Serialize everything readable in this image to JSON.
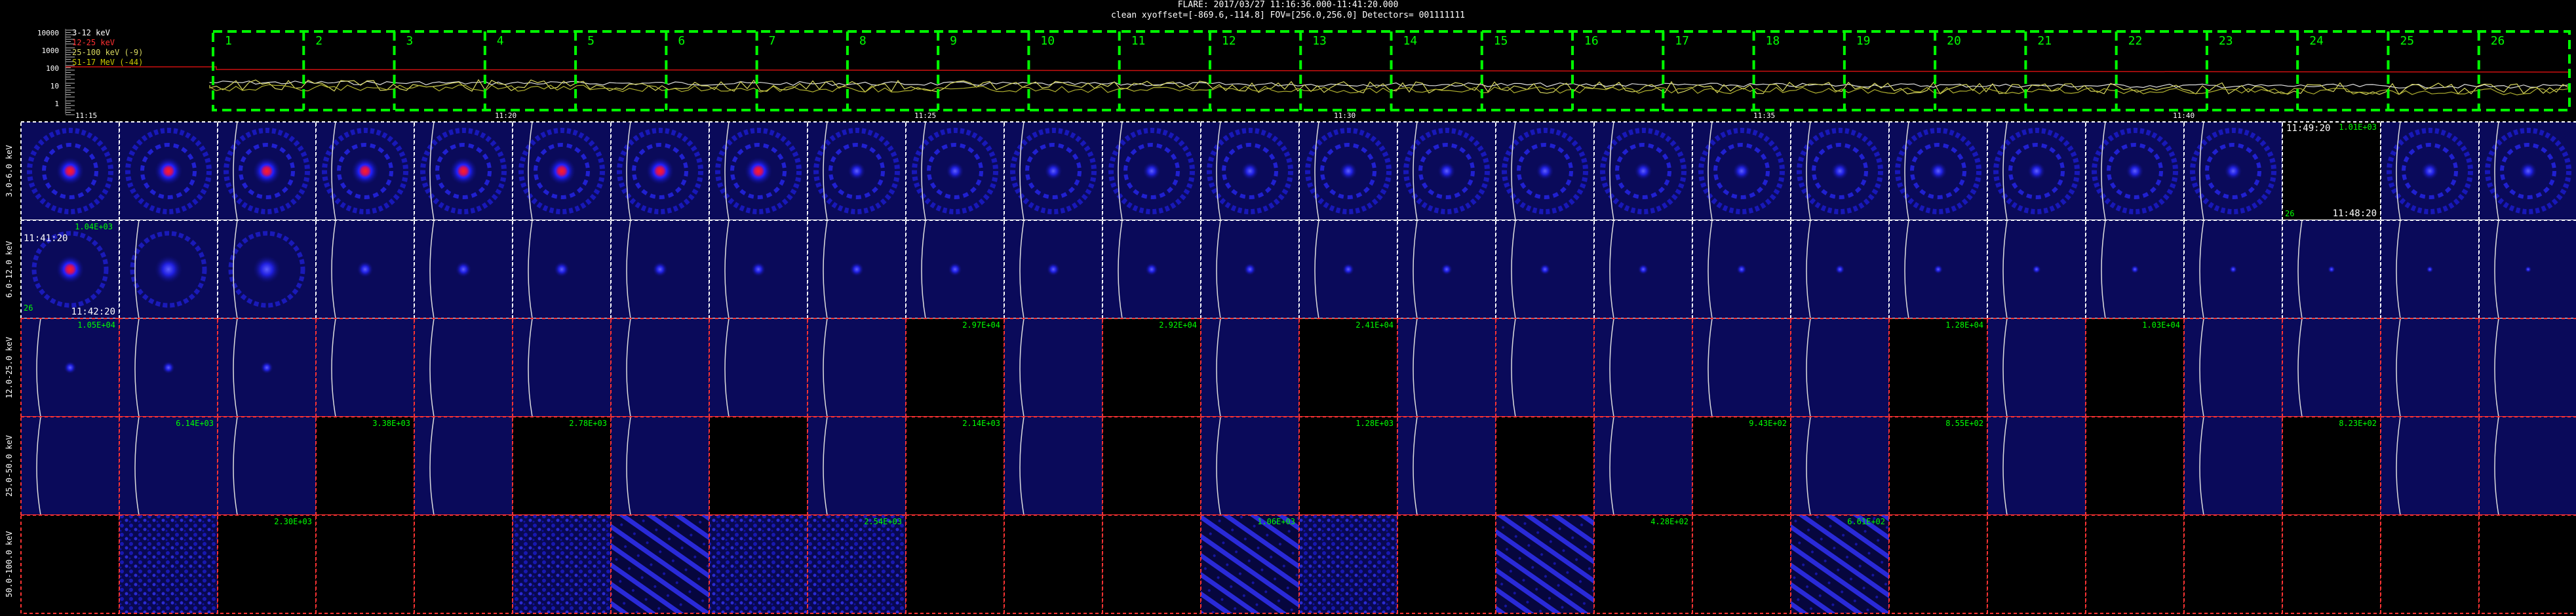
{
  "header": {
    "line1": "FLARE: 2017/03/27  11:16:36.000-11:41:20.000",
    "line2": "clean    xyoffset=[-869.6,-114.8]    FOV=[256.0,256.0]    Detectors= 001111111"
  },
  "lightcurve": {
    "y_ticks": [
      "10000",
      "1000",
      "100",
      "10",
      "1"
    ],
    "legend": [
      "3-12 keV",
      "12-25 keV",
      "25-100 keV (-9)",
      "S1-17 MeV (-44)"
    ],
    "legend_colors": [
      "#ffffff",
      "#ff3030",
      "#d8d860",
      "#c8c800"
    ],
    "time_ticks": [
      "11:15",
      "11:20",
      "11:25",
      "11:30",
      "11:35",
      "11:40"
    ],
    "interval_labels": [
      "1",
      "2",
      "3",
      "4",
      "5",
      "6",
      "7",
      "8",
      "9",
      "10",
      "11",
      "12",
      "13",
      "14",
      "15",
      "16",
      "17",
      "18",
      "19",
      "20",
      "21",
      "22",
      "23",
      "24",
      "25",
      "26"
    ]
  },
  "rows": [
    {
      "label": "3.0-6.0 keV"
    },
    {
      "label": "6.0-12.0 keV"
    },
    {
      "label": "12.0-25.0 keV"
    },
    {
      "label": "25.0-50.0 keV"
    },
    {
      "label": "50.0-100.0 keV"
    }
  ],
  "cell_annotations": {
    "r0c23_time": "11:49:20",
    "r0c23_value": "1.01E+03",
    "r0c23_index": "26",
    "r0c23_endtime": "11:48:20",
    "r1c0_value": "1.04E+03",
    "r1c0_time": "11:41:20",
    "r1c0_endtime": "11:42:20",
    "r1c0_index": "26",
    "r2_values": [
      "1.05E+04",
      "2.97E+04",
      "2.92E+04",
      "2.41E+04",
      "1.28E+04",
      "1.03E+04"
    ],
    "r3_values": [
      "6.14E+03",
      "3.38E+03",
      "2.78E+03",
      "2.14E+03",
      "1.28E+03",
      "9.43E+02",
      "8.55E+02",
      "8.23E+02"
    ],
    "r4_values": [
      "2.30E+03",
      "2.54E+03",
      "1.06E+03",
      "4.28E+02",
      "6.61E+02"
    ]
  },
  "colors": {
    "interval_box": "#00ff00",
    "white_border": "#ffffff",
    "red_border": "#ff3333",
    "image_bg": "#0a0a5a",
    "label_green": "#00ff00",
    "label_white": "#ffffff"
  }
}
